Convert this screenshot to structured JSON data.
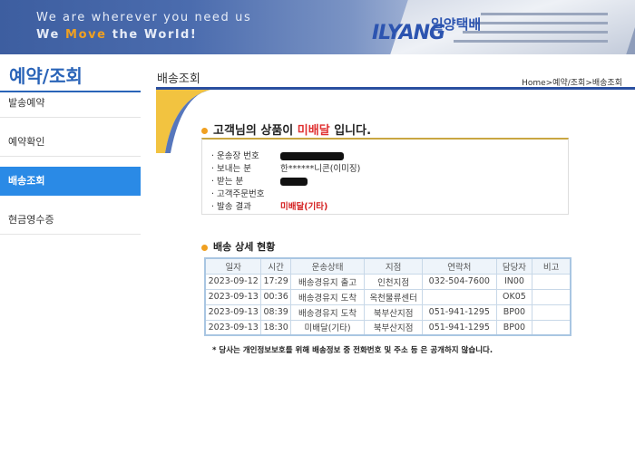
{
  "header": {
    "tagline_line1": "We are wherever you need us",
    "tagline_line2_a": "We ",
    "tagline_line2_b": "Move",
    "tagline_line2_c": " the World!",
    "logo_text": "ILYANG",
    "logo_kr": "일양택배",
    "accent_color": "#f0a020"
  },
  "sidebar": {
    "title": "예약/조회",
    "items": [
      {
        "label": "발송예약"
      },
      {
        "label": "예약확인"
      },
      {
        "label": "배송조회"
      },
      {
        "label": "현금영수증"
      }
    ],
    "active_color": "#2a8ae6"
  },
  "main": {
    "title": "배송조회",
    "breadcrumb": "Home>예약/조회>배송조회"
  },
  "status": {
    "prefix": "고객님의 상품이 ",
    "state": "미배달",
    "suffix": " 입니다."
  },
  "info": {
    "rows": [
      {
        "label": "· 운송장 번호",
        "value": ""
      },
      {
        "label": "· 보내는 분",
        "value": "한******니콘(이미징)"
      },
      {
        "label": "· 받는 분",
        "value": ""
      },
      {
        "label": "· 고객주문번호",
        "value": ""
      },
      {
        "label": "· 발송 결과",
        "value": "미배달(기타)"
      }
    ]
  },
  "detail": {
    "heading": "배송 상세 현황",
    "columns": [
      "일자",
      "시간",
      "운송상태",
      "지점",
      "연락처",
      "담당자",
      "비고"
    ],
    "rows": [
      [
        "2023-09-12",
        "17:29",
        "배송경유지 출고",
        "인천지점",
        "032-504-7600",
        "IN00",
        ""
      ],
      [
        "2023-09-13",
        "00:36",
        "배송경유지 도착",
        "옥천물류센터",
        "",
        "OK05",
        ""
      ],
      [
        "2023-09-13",
        "08:39",
        "배송경유지 도착",
        "북부산지점",
        "051-941-1295",
        "BP00",
        ""
      ],
      [
        "2023-09-13",
        "18:30",
        "미배달(기타)",
        "북부산지점",
        "051-941-1295",
        "BP00",
        ""
      ]
    ],
    "notice": "* 당사는 개인정보보호를 위해 배송정보 중 전화번호 및 주소 등 은 공개하지 않습니다."
  }
}
